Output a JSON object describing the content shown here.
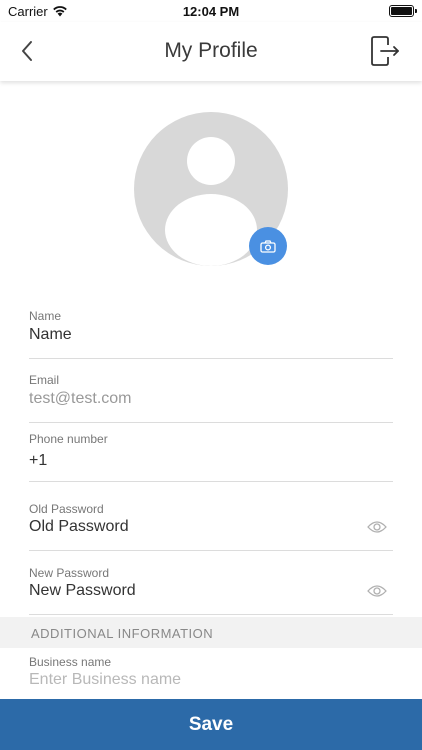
{
  "status_bar": {
    "carrier": "Carrier",
    "time": "12:04 PM"
  },
  "nav": {
    "title": "My Profile",
    "back_icon": "chevron-left-icon",
    "logout_icon": "logout-icon"
  },
  "avatar": {
    "camera_icon": "camera-icon",
    "accent": "#4a90e2"
  },
  "fields": {
    "name": {
      "label": "Name",
      "value": "Name"
    },
    "email": {
      "label": "Email",
      "value": "test@test.com"
    },
    "phone": {
      "label": "Phone number",
      "value": "+1"
    },
    "old_password": {
      "label": "Old Password",
      "value": "Old Password"
    },
    "new_password": {
      "label": "New Password",
      "value": "New Password"
    }
  },
  "section": {
    "title": "ADDITIONAL INFORMATION"
  },
  "business": {
    "label": "Business name",
    "placeholder": "Enter Business name"
  },
  "save": {
    "label": "Save",
    "color": "#2c6aa8"
  }
}
